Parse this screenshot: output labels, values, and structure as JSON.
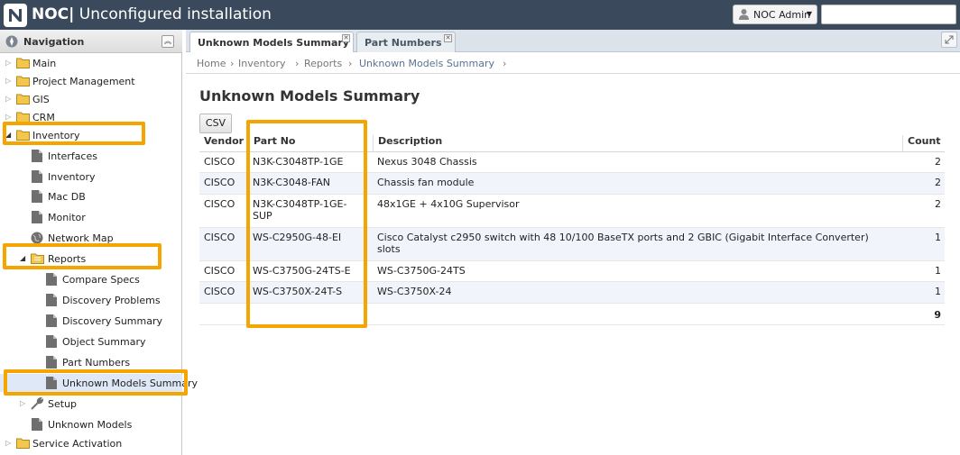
{
  "app": {
    "brand": "NOC|",
    "title": "Unconfigured installation",
    "user_label": "NOC Admin"
  },
  "nav": {
    "title": "Navigation",
    "items": [
      {
        "label": "Main"
      },
      {
        "label": "Project Management"
      },
      {
        "label": "GIS"
      },
      {
        "label": "CRM"
      },
      {
        "label": "Inventory"
      },
      {
        "label": "Interfaces"
      },
      {
        "label": "Inventory"
      },
      {
        "label": "Mac DB"
      },
      {
        "label": "Monitor"
      },
      {
        "label": "Network Map"
      },
      {
        "label": "Reports"
      },
      {
        "label": "Compare Specs"
      },
      {
        "label": "Discovery Problems"
      },
      {
        "label": "Discovery Summary"
      },
      {
        "label": "Object Summary"
      },
      {
        "label": "Part Numbers"
      },
      {
        "label": "Unknown Models Summary"
      },
      {
        "label": "Setup"
      },
      {
        "label": "Unknown Models"
      },
      {
        "label": "Service Activation"
      }
    ]
  },
  "tabs": [
    {
      "label": "Unknown Models Summary"
    },
    {
      "label": "Part Numbers"
    }
  ],
  "breadcrumb": [
    "Home",
    "Inventory",
    "Reports",
    "Unknown Models Summary"
  ],
  "breadcrumb_sep": "›",
  "report": {
    "title": "Unknown Models Summary",
    "csv_label": "CSV",
    "columns": {
      "vendor": "Vendor",
      "part_no": "Part No",
      "description": "Description",
      "count": "Count"
    },
    "rows": [
      {
        "vendor": "CISCO",
        "part_no": "N3K-C3048TP-1GE",
        "description": "Nexus 3048 Chassis",
        "count": "2"
      },
      {
        "vendor": "CISCO",
        "part_no": "N3K-C3048-FAN",
        "description": "Chassis fan module",
        "count": "2"
      },
      {
        "vendor": "CISCO",
        "part_no": "N3K-C3048TP-1GE-\nSUP",
        "description": "48x1GE + 4x10G Supervisor",
        "count": "2"
      },
      {
        "vendor": "CISCO",
        "part_no": "WS-C2950G-48-EI",
        "description": "Cisco Catalyst c2950 switch with 48 10/100 BaseTX ports and 2 GBIC (Gigabit Interface Converter)\nslots",
        "count": "1"
      },
      {
        "vendor": "CISCO",
        "part_no": "WS-C3750G-24TS-E",
        "description": "WS-C3750G-24TS",
        "count": "1"
      },
      {
        "vendor": "CISCO",
        "part_no": "WS-C3750X-24T-S",
        "description": "WS-C3750X-24",
        "count": "1"
      }
    ],
    "total": "9"
  },
  "colors": {
    "header_bg": "#3a4a5c",
    "highlight": "#f6a400",
    "alt_row": "#f1f5fb",
    "folder": "#f3c64e"
  }
}
